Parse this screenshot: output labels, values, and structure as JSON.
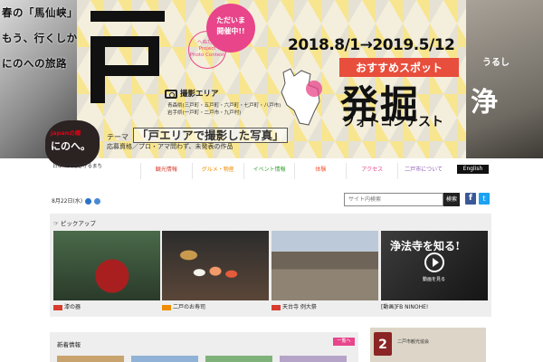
{
  "hero": {
    "left_poem": [
      "春の「馬仙峡」を見だけ",
      "もう、行くしか無いよ",
      "にのへの旅路"
    ],
    "project_circle": [
      "へぬだり",
      "Project",
      "Photo Contest"
    ],
    "tadaima": [
      "ただいま",
      "開催中!!"
    ],
    "camera_area_label": "撮影エリア",
    "area_lines": [
      "青森県(三戸町・五戸町・六戸町・七戸町・八戸市)",
      "岩手県(一戸町・二戸市・九戸村)"
    ],
    "date_range": "2018.8/1→2019.5/12",
    "osusume": "おすすめスポット",
    "hakkutsu": "発掘",
    "photocontest": "フォトコンテスト",
    "theme_label": "テーマ",
    "theme_title": "「戸エリアで撮影した写真」",
    "oubo": "応募資格／プロ・アマ問わず、未発表の作品",
    "right_poem": "うるし",
    "right_jo": "浄"
  },
  "logo": {
    "text_top": "japanの郷",
    "text_main": "にのへ。",
    "caption": "日本の文化を守るまち"
  },
  "nav": {
    "items": [
      "観光情報",
      "グルメ・物産",
      "イベント情報",
      "体験",
      "アクセス",
      "二戸市について"
    ],
    "english": "English"
  },
  "date_bar": {
    "today": "8月22日(水)"
  },
  "search": {
    "placeholder": "サイト内検索",
    "button": "検索"
  },
  "social": {
    "facebook": "f",
    "twitter": "t"
  },
  "picks": {
    "heading": "ピックアップ",
    "cards": [
      {
        "caption": "漆の器"
      },
      {
        "caption": "二戸のお寿司"
      },
      {
        "caption": "天台寺 例大祭"
      },
      {
        "caption": "[動画]FB NINOHE!"
      }
    ],
    "video_text": "浄法寺を知る!",
    "video_sub": "動画を見る"
  },
  "bottom": {
    "heading": "新着情報",
    "more": "一覧へ",
    "banner_badge": "2",
    "banner_text": "二戸市観光協会"
  }
}
